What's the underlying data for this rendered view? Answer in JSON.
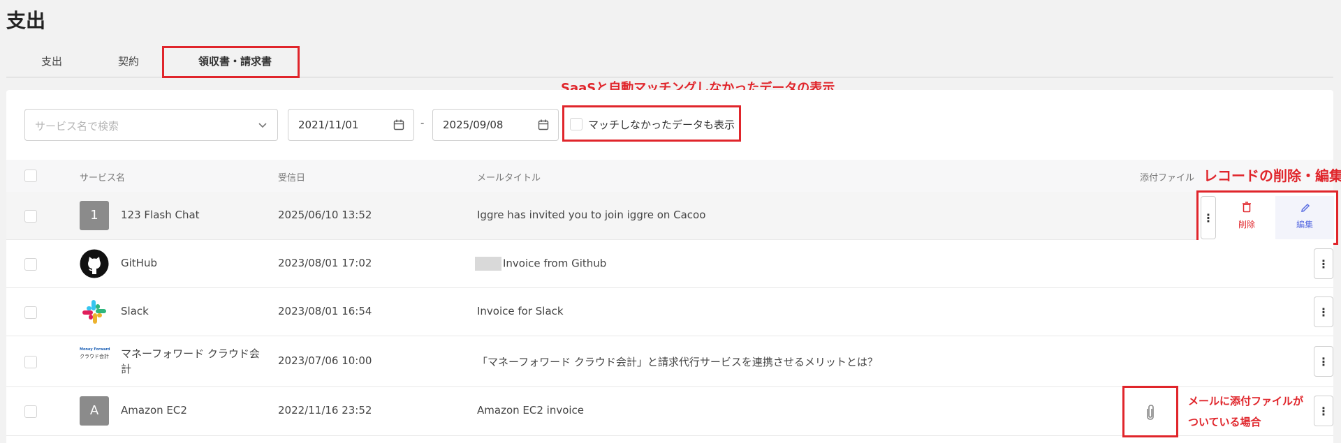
{
  "page": {
    "title": "支出"
  },
  "tabs": [
    {
      "label": "支出"
    },
    {
      "label": "契約"
    },
    {
      "label": "領収書・請求書"
    }
  ],
  "annotations": {
    "unmatched": "SaaSと自動マッチングしなかったデータの表示",
    "record_actions": "レコードの削除・編集",
    "attachment_line1": "メールに添付ファイルが",
    "attachment_line2": "ついている場合"
  },
  "filters": {
    "service_placeholder": "サービス名で検索",
    "date_from": "2021/11/01",
    "date_separator": "-",
    "date_to": "2025/09/08",
    "show_unmatched_label": "マッチしなかったデータも表示"
  },
  "table": {
    "columns": {
      "service": "サービス名",
      "received": "受信日",
      "mail_title": "メールタイトル",
      "attachment": "添付ファイル"
    },
    "rows": [
      {
        "avatar": "1",
        "service": "123 Flash Chat",
        "received": "2025/06/10 13:52",
        "title": "Iggre has invited you to join iggre on Cacoo"
      },
      {
        "service": "GitHub",
        "received": "2023/08/01 17:02",
        "title": "Invoice from Github"
      },
      {
        "service": "Slack",
        "received": "2023/08/01 16:54",
        "title": "Invoice for Slack"
      },
      {
        "service_line1": "マネーフォワード クラウド会",
        "service_line2": "計",
        "logo_text1": "Money Forward",
        "logo_text2": "クラウド会計",
        "received": "2023/07/06 10:00",
        "title": "「マネーフォワード クラウド会計」と請求代行サービスを連携させるメリットとは？"
      },
      {
        "avatar": "A",
        "service": "Amazon EC2",
        "received": "2022/11/16 23:52",
        "title": "Amazon EC2 invoice"
      }
    ],
    "actions": {
      "delete_label": "削除",
      "edit_label": "編集",
      "kebab": "⋮"
    }
  },
  "colors": {
    "annotation_red": "#e0252b",
    "delete_red": "#e0252b",
    "edit_blue": "#5b6ee1"
  },
  "icons": [
    "calendar-icon",
    "chevron-down-icon",
    "github-icon",
    "slack-icon",
    "trash-icon",
    "pencil-icon",
    "paperclip-icon",
    "more-vertical-icon"
  ]
}
